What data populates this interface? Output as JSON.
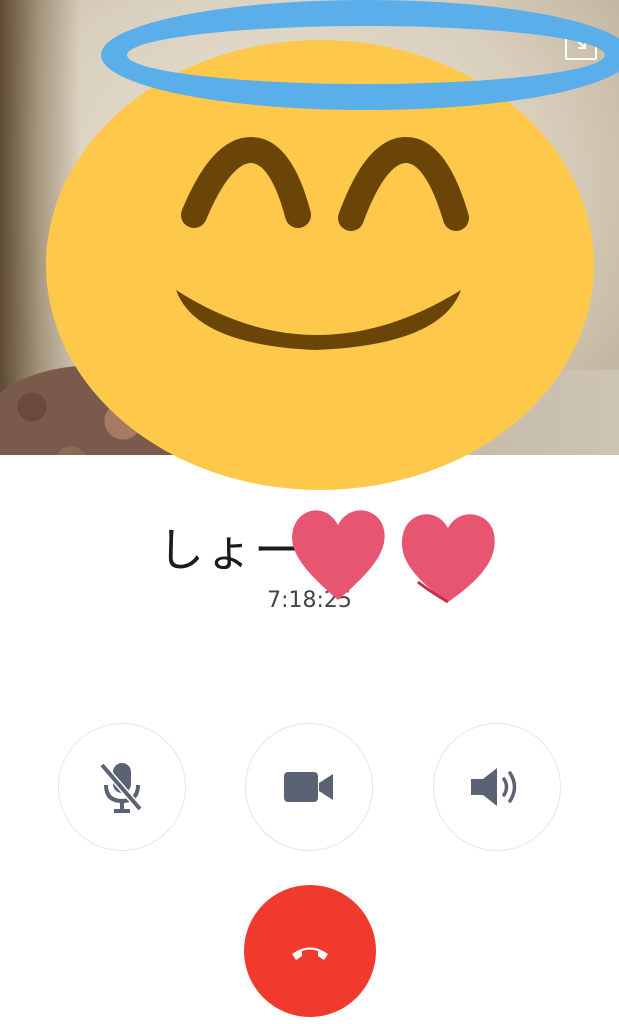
{
  "caller": {
    "name": "しょー",
    "duration": "7:18:25"
  },
  "controls": {
    "mute_icon": "mic-off-icon",
    "video_icon": "video-camera-icon",
    "speaker_icon": "speaker-icon",
    "end_icon": "hang-up-icon"
  },
  "colors": {
    "end_call": "#f03a2e",
    "icon": "#5a6273",
    "emoji_face": "#fec84a",
    "halo": "#5aaeea",
    "heart": "#e85570"
  },
  "overlays": {
    "emoji": "smiling-face-with-halo",
    "hearts": "two-hearts"
  }
}
